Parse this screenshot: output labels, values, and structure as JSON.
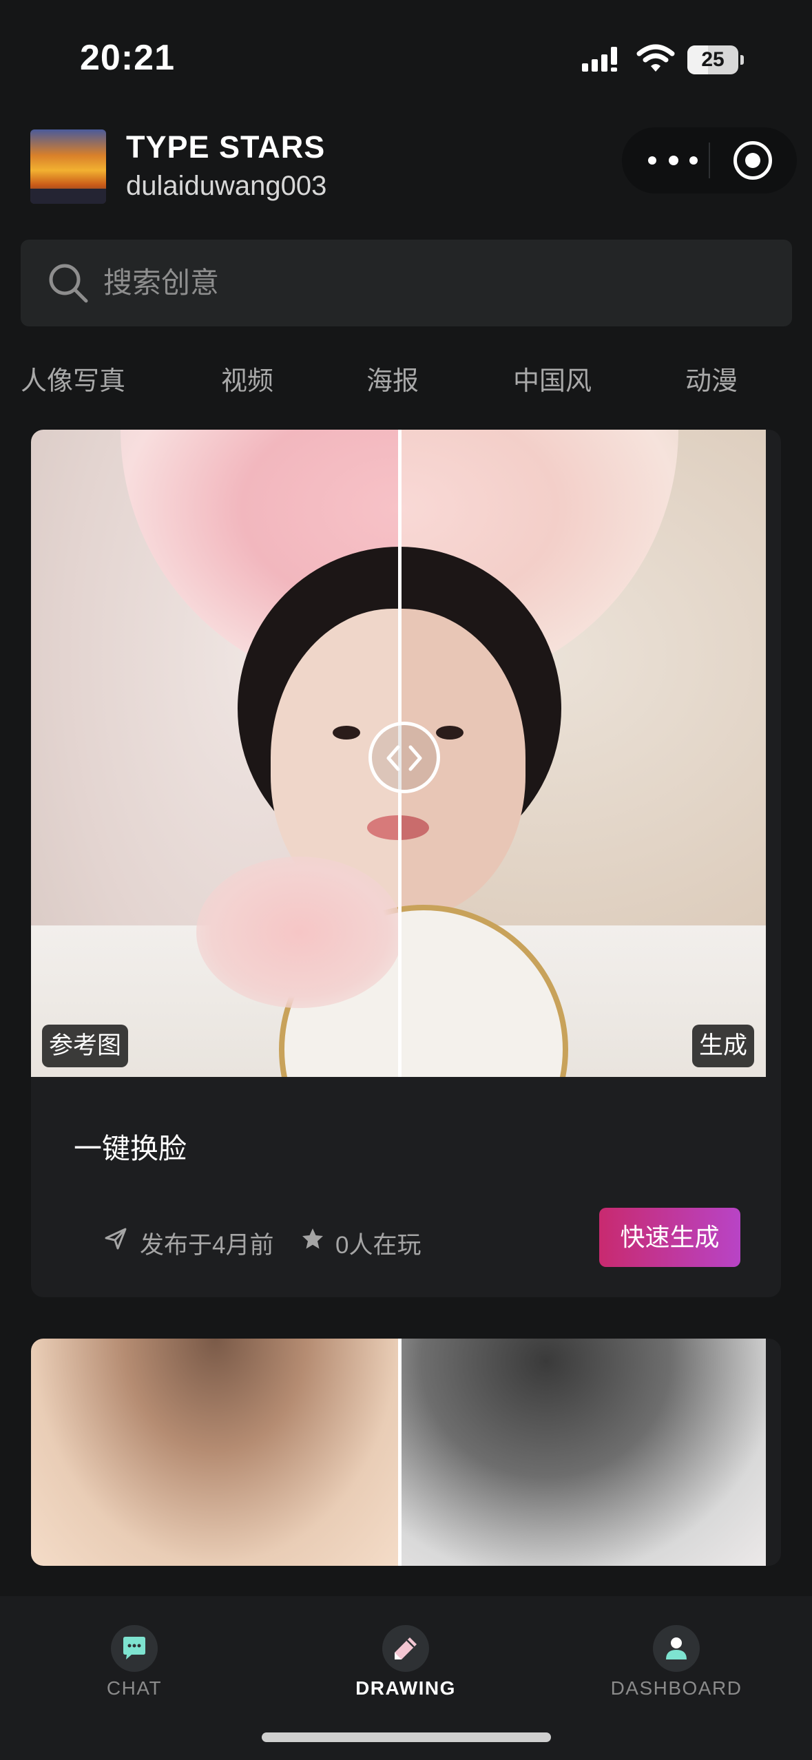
{
  "status_bar": {
    "time": "20:21",
    "battery": "25"
  },
  "header": {
    "title": "TYPE STARS",
    "username": "dulaiduwang003"
  },
  "search": {
    "placeholder": "搜索创意"
  },
  "tabs": [
    "人像写真",
    "视频",
    "海报",
    "中国风",
    "动漫"
  ],
  "cards": [
    {
      "ref_label": "参考图",
      "gen_label": "生成",
      "title": "一键换脸",
      "published": "发布于4月前",
      "players": "0人在玩",
      "action": "快速生成"
    }
  ],
  "bottom_nav": [
    {
      "label": "CHAT",
      "icon": "chat-icon",
      "active": false
    },
    {
      "label": "DRAWING",
      "icon": "pencil-icon",
      "active": true
    },
    {
      "label": "DASHBOARD",
      "icon": "user-icon",
      "active": false
    }
  ],
  "colors": {
    "background": "#151617",
    "card": "#1d1e20",
    "accent_start": "#c82a6f",
    "accent_end": "#b844c6",
    "icon_accent": "#7ee3d0"
  }
}
